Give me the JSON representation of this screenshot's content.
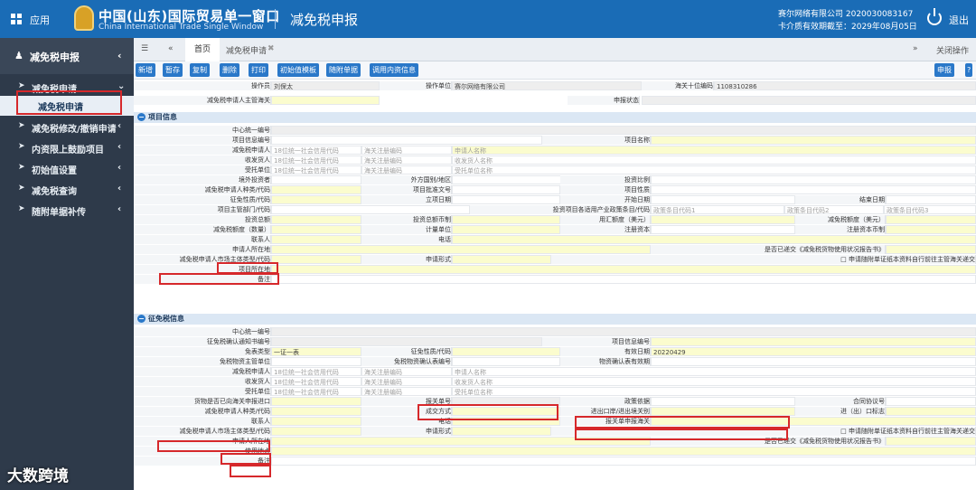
{
  "topbar": {
    "app_label": "应用",
    "title": "中国(山东)国际贸易单一窗口",
    "subtitle": "China International Trade Single Window",
    "module": "减免税申报",
    "company": "赛尔网络有限公司 2020030083167",
    "expire": "卡介质有效期截至：2029年08月05日",
    "exit": "退出"
  },
  "sidebar": {
    "header": "减免税申报",
    "items": [
      {
        "label": "减免税申请"
      },
      {
        "label": "减免税申请"
      },
      {
        "label": "减免税修改/撤销申请"
      },
      {
        "label": "内资限上鼓励项目"
      },
      {
        "label": "初始值设置"
      },
      {
        "label": "减免税查询"
      },
      {
        "label": "随附单据补传"
      }
    ]
  },
  "tabs": {
    "home": "首页",
    "current": "减免税申请",
    "close_ops": "关闭操作"
  },
  "toolbar": {
    "buttons": [
      "新增",
      "暂存",
      "复制",
      "删除",
      "打印",
      "初始值模板",
      "随附单据",
      "调用内资信息"
    ],
    "declare": "申报"
  },
  "header_rows": [
    {
      "labels": [
        "操作员",
        "操作单位",
        "海关十位编码"
      ],
      "values": [
        "刘保太",
        "赛尔网络有限公司",
        "1108310286"
      ]
    },
    {
      "labels": [
        "减免税申请人主管海关",
        "申报状态"
      ],
      "values": [
        "",
        ""
      ]
    }
  ],
  "project": {
    "title": "项目信息",
    "labels": [
      "中心统一编号",
      "项目信息编号",
      "项目名称",
      "减免税申请人",
      "收发货人",
      "受托单位",
      "境外投资者",
      "外方国别/地区",
      "投资比例",
      "减免税申请人种类/代码",
      "项目批准文号",
      "项目性质",
      "征免性质/代码",
      "立项日期",
      "开始日期",
      "结束日期",
      "项目主管部门/代码",
      "投资项目各适用产业政策条目/代码",
      "投资总额",
      "投资总额币制",
      "用汇额度（美元）",
      "减免税额度（美元）",
      "减免税额度（数量）",
      "计量单位",
      "注册资本",
      "注册资本币制",
      "联系人",
      "电话",
      "申请人所在地",
      "是否已递交《减免税货物使用状况报告书》",
      "减免税申请人市场主体类型/代码",
      "申请形式",
      "申请随附单证纸本资料自行前往主管海关递交",
      "项目所在地",
      "备注"
    ],
    "placeholders": [
      "18位统一社会信用代码",
      "海关注册编码",
      "申请人名称",
      "18位统一社会信用代码",
      "海关注册编码",
      "收发货人名称",
      "18位统一社会信用代码",
      "海关注册编码",
      "受托单位名称",
      "政策条目代码1",
      "政策条目代码2",
      "政策条目代码3"
    ]
  },
  "exempt": {
    "title": "征免税信息",
    "labels": [
      "中心统一编号",
      "征免税确认通知书编号",
      "项目信息编号",
      "免表类型",
      "征免性质/代码",
      "有效日期",
      "免税物资主管单位",
      "免税物资确认表编号",
      "物资确认表有效期",
      "减免税申请人",
      "收发货人",
      "受托单位",
      "货物是否已向海关申报进口",
      "报关单号",
      "政策依据",
      "合同协议号",
      "减免税申请人种类/代码",
      "成交方式",
      "进出口岸/进出境关别",
      "进（出）口标志",
      "联系人",
      "电话",
      "报关单申报海关",
      "减免税申请人市场主体类型/代码",
      "申请形式",
      "申请随附单证纸本资料自行前往主管海关递交",
      "申请人所在地",
      "是否已递交《减免税货物使用状况报告书》",
      "使用地点",
      "备注"
    ],
    "values": {
      "form_type": "一证一表",
      "valid_date": "20220429"
    },
    "placeholders": [
      "18位统一社会信用代码",
      "海关注册编码",
      "申请人名称",
      "18位统一社会信用代码",
      "海关注册编码",
      "收发货人名称",
      "18位统一社会信用代码",
      "海关注册编码",
      "受托单位名称"
    ]
  },
  "watermark": "大数跨境"
}
